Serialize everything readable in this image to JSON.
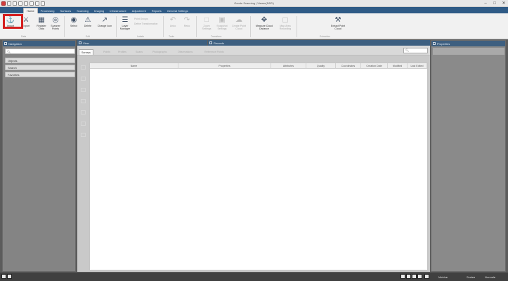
{
  "window": {
    "title": "Geode Scanning | Viewer(FAPI)"
  },
  "file_tab": "FILE",
  "ribbon_tabs": [
    "Home",
    "Processing",
    "Surfaces",
    "Scanning",
    "Imaging",
    "Infrastructure",
    "Adjustment",
    "Reports",
    "General Settings"
  ],
  "ribbon": {
    "buttons": [
      {
        "label": "Import",
        "icon": "import-icon"
      },
      {
        "label": "Export",
        "icon": "export-icon"
      },
      {
        "label": "Register Data",
        "icon": "register-icon"
      },
      {
        "label": "Scanner Points",
        "icon": "scanner-points-icon"
      },
      {
        "label": "Select",
        "icon": "select-icon"
      },
      {
        "label": "Delete",
        "icon": "delete-icon"
      },
      {
        "label": "Change Icon",
        "icon": "change-icon"
      },
      {
        "label": "Layer Manager",
        "icon": "layer-icon"
      }
    ],
    "dim_buttons": [
      {
        "label": "Point Groups",
        "icon": "point-groups-icon"
      },
      {
        "label": "Define Transformation",
        "icon": "transform-icon"
      },
      {
        "label": "Undo",
        "icon": "undo-icon"
      },
      {
        "label": "Redo",
        "icon": "redo-icon"
      },
      {
        "label": "Zoom Settings",
        "icon": "zoom-icon"
      },
      {
        "label": "Snapshot Settings",
        "icon": "snapshot-icon"
      },
      {
        "label": "Create Point Cloud",
        "icon": "cloud-icon"
      },
      {
        "label": "Map Area Recording",
        "icon": "map-icon"
      }
    ],
    "right_buttons": [
      {
        "label": "Measure Cloud Distance",
        "icon": "measure-icon"
      },
      {
        "label": "Extract Point Cloud",
        "icon": "extract-icon"
      }
    ],
    "group_labels": [
      "Data",
      "Edit",
      "Labels",
      "Tools",
      "Transform",
      "Extraction"
    ]
  },
  "navigation": {
    "header": "Navigation",
    "search_placeholder": "",
    "items": [
      "Objects",
      "Search",
      "Favorites"
    ]
  },
  "view_panel": {
    "header": "View"
  },
  "records_panel": {
    "header": "Records"
  },
  "center_tabs": [
    "Surveys",
    "Points",
    "Profiles",
    "Scans",
    "Photographs",
    "Observations",
    "Reference Points"
  ],
  "grid_columns": [
    "Name",
    "Properties",
    "Attributes",
    "Quality",
    "Coordinates",
    "Creation Date",
    "Modified",
    "Last Edited"
  ],
  "properties_panel": {
    "header": "Properties"
  },
  "status_bar": {
    "items": [
      "Metric",
      "Scale",
      "Normal"
    ]
  }
}
